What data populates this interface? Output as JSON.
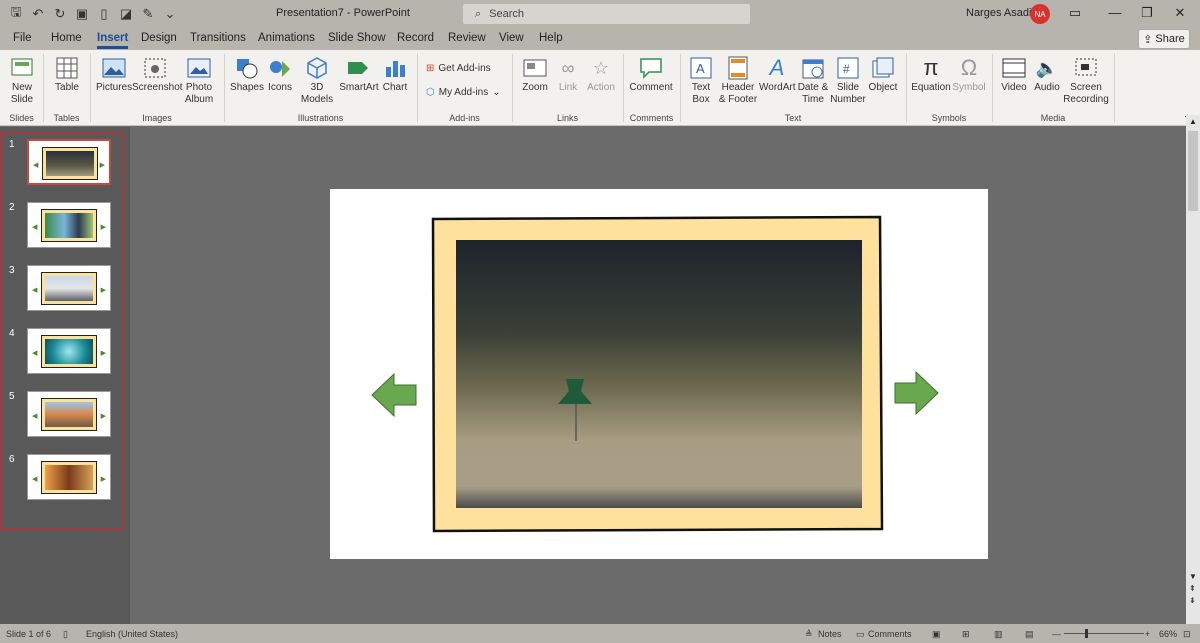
{
  "app": {
    "doc_title": "Presentation7  -  PowerPoint",
    "search_placeholder": "Search",
    "user_name": "Narges Asadi",
    "user_initials": "NA",
    "share_label": "Share"
  },
  "tabs": [
    "File",
    "Home",
    "Insert",
    "Design",
    "Transitions",
    "Animations",
    "Slide Show",
    "Record",
    "Review",
    "View",
    "Help"
  ],
  "active_tab": "Insert",
  "ribbon": {
    "new_slide": [
      "New",
      "Slide"
    ],
    "table": "Table",
    "pictures": "Pictures",
    "screenshot": "Screenshot",
    "photo_album": [
      "Photo",
      "Album"
    ],
    "shapes": "Shapes",
    "icons": "Icons",
    "models_3d": [
      "3D",
      "Models"
    ],
    "smartart": "SmartArt",
    "chart": "Chart",
    "get_addins": "Get Add-ins",
    "my_addins": "My Add-ins",
    "zoom": "Zoom",
    "link": "Link",
    "action": "Action",
    "comment": "Comment",
    "text_box": [
      "Text",
      "Box"
    ],
    "header_footer": [
      "Header",
      "& Footer"
    ],
    "wordart": "WordArt",
    "date_time": [
      "Date &",
      "Time"
    ],
    "slide_number": [
      "Slide",
      "Number"
    ],
    "object": "Object",
    "equation": "Equation",
    "symbol": "Symbol",
    "video": "Video",
    "audio": "Audio",
    "screen_recording": [
      "Screen",
      "Recording"
    ],
    "groups": [
      "Slides",
      "Tables",
      "Images",
      "Illustrations",
      "Add-ins",
      "Links",
      "Comments",
      "Text",
      "Symbols",
      "Media"
    ]
  },
  "slides": [
    {
      "n": "1",
      "theme": "dark"
    },
    {
      "n": "2",
      "theme": "people"
    },
    {
      "n": "3",
      "theme": "road"
    },
    {
      "n": "4",
      "theme": "teal"
    },
    {
      "n": "5",
      "theme": "desert"
    },
    {
      "n": "6",
      "theme": "orange"
    }
  ],
  "status": {
    "slide_info": "Slide 1 of 6",
    "language": "English (United States)",
    "notes": "Notes",
    "comments": "Comments",
    "zoom": "66%"
  },
  "colors": {
    "accent": "#1b4f99",
    "arrow": "#6aa84f",
    "frame": "#fbe29a",
    "avatar": "#d9312b"
  }
}
